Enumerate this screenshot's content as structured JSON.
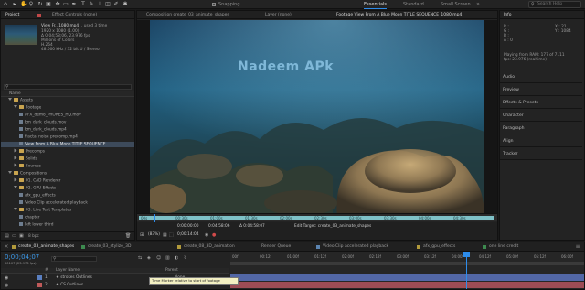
{
  "app": {
    "workspaces": [
      "Essentials",
      "Standard",
      "Small Screen"
    ],
    "active_workspace": 0,
    "search_placeholder": "Search Help",
    "snapping_label": "Snapping"
  },
  "project_panel": {
    "tabs": [
      "Project",
      "Effect Controls (none)"
    ],
    "item_name": "View Fr...1080.mp4",
    "item_used": ", used 3 time",
    "meta": [
      "1920 x 1080 (1.00)",
      "Δ 0;04;58;06, 23.976 fps",
      "Millions of Colors",
      "H.264",
      "48.000 kHz / 32 bit U / Stereo"
    ],
    "column_header": "Name",
    "tree": [
      {
        "label": "Assets",
        "kind": "folder",
        "indent": 1,
        "open": true
      },
      {
        "label": "Footage",
        "kind": "folder",
        "indent": 2,
        "open": true
      },
      {
        "label": "AFX_demo_PRORES_HQ.mov",
        "kind": "file",
        "indent": 3
      },
      {
        "label": "bm_dark_clouds.mov",
        "kind": "file",
        "indent": 3
      },
      {
        "label": "bm_dark_clouds.mp4",
        "kind": "file",
        "indent": 3
      },
      {
        "label": "fractal noise precomp.mp4",
        "kind": "file",
        "indent": 3
      },
      {
        "label": "View From A Blue Moon TITLE SEQUENCE",
        "kind": "file",
        "indent": 3,
        "selected": true
      },
      {
        "label": "Precomps",
        "kind": "folder",
        "indent": 2
      },
      {
        "label": "Solids",
        "kind": "folder",
        "indent": 2
      },
      {
        "label": "Sources",
        "kind": "folder",
        "indent": 2
      },
      {
        "label": "Compositions",
        "kind": "folder",
        "indent": 1,
        "open": true
      },
      {
        "label": "01. CAD Renderer",
        "kind": "folder",
        "indent": 2
      },
      {
        "label": "02. GPU Effects",
        "kind": "folder",
        "indent": 2,
        "open": true
      },
      {
        "label": "afx_gpu_effects",
        "kind": "file",
        "indent": 3
      },
      {
        "label": "Video Clip accelerated playback",
        "kind": "file",
        "indent": 3
      },
      {
        "label": "03. Live Text Templates",
        "kind": "folder",
        "indent": 2,
        "open": true
      },
      {
        "label": "chapter",
        "kind": "file",
        "indent": 3
      },
      {
        "label": "left lower third",
        "kind": "file",
        "indent": 3
      }
    ],
    "bpc": "8 bpc"
  },
  "viewer": {
    "tabs": [
      "Composition create_03_animate_shapes",
      "Layer (none)",
      "Footage View From A Blue Moon TITLE SEQUENCE_1080.mp4"
    ],
    "watermark": "Nadeem APk",
    "ruler_ticks": [
      "00s",
      "00:30s",
      "01:00s",
      "01:30s",
      "02:00s",
      "02:30s",
      "03:00s",
      "03:30s",
      "04:00s",
      "04:30s"
    ],
    "zoom": "(83%)",
    "timecode": "0;00:14:04",
    "in_point": "0:00:00:00",
    "out_point": "0:04:58:06",
    "duration": "Δ 0:04:58:07",
    "edit_target": "Edit Target: create_03_animate_shapes"
  },
  "info_panel": {
    "title": "Info",
    "rgb_labels": [
      "R :",
      "G :",
      "B :",
      "A : 0"
    ],
    "coords": [
      "X : 21",
      "Y : 1084"
    ],
    "playing_from": "Playing from RAM: 177 of 7111",
    "fps": "fps: 23.976 (realtime)",
    "sections": [
      "Audio",
      "Preview",
      "Effects & Presets",
      "Character",
      "Paragraph",
      "Align",
      "Tracker"
    ]
  },
  "timeline": {
    "tabs": [
      "create_03_animate_shapes",
      "create_03_stylize_3D",
      "create_08_3D_animation",
      "Render Queue",
      "Video Clip accelerated playback",
      "afx_gpu_effects",
      "one line credit"
    ],
    "tab_colors": [
      "#b19a3b",
      "#3d8a4f",
      "#b19a3b",
      "",
      "#5b84b0",
      "#b19a3b",
      "#3d8a4f"
    ],
    "timecode": "0;00;04;07",
    "frame_info": "00107 (23.976 fps)",
    "column_labels": [
      "#",
      "Layer Name",
      "Parent"
    ],
    "layers": [
      {
        "num": "1",
        "name": "★ strokes Outlines",
        "parent": "None",
        "color": "#5a7fc0"
      },
      {
        "num": "2",
        "name": "★ CS Outlines",
        "parent": "None",
        "color": "#c05a5a"
      }
    ],
    "ruler_ticks": [
      "00f",
      "00:12f",
      "01:00f",
      "01:12f",
      "02:00f",
      "02:12f",
      "03:00f",
      "03:12f",
      "04:00f",
      "04:12f",
      "05:00f",
      "05:12f",
      "06:00f"
    ],
    "tooltip": "Time Marker relative to start of footage"
  }
}
